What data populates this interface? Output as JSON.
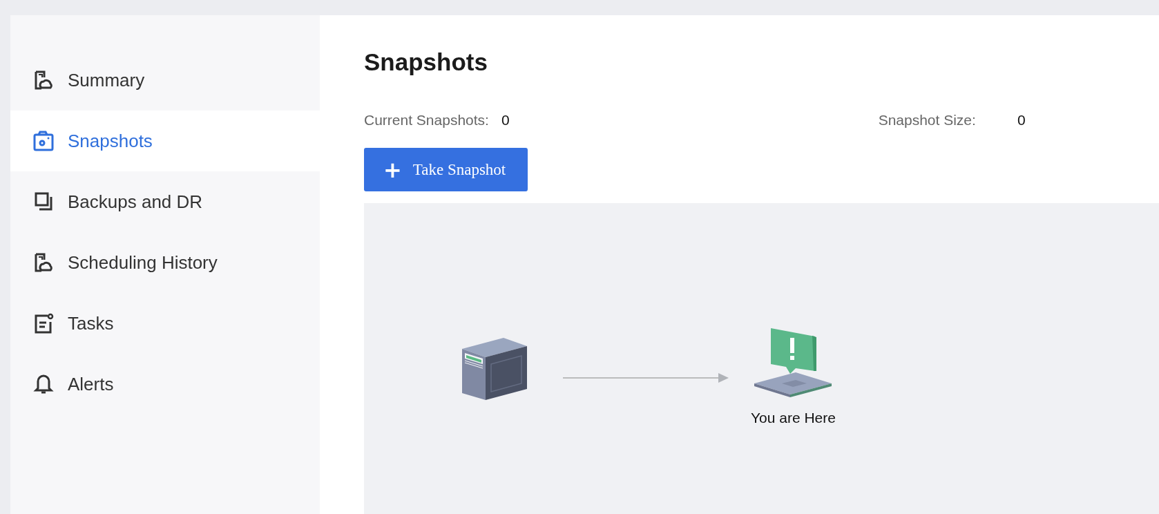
{
  "sidebar": {
    "items": [
      {
        "label": "Summary",
        "kind": "report",
        "selected": false
      },
      {
        "label": "Snapshots",
        "kind": "camera",
        "selected": true
      },
      {
        "label": "Backups and DR",
        "kind": "copy",
        "selected": false
      },
      {
        "label": "Scheduling History",
        "kind": "report",
        "selected": false
      },
      {
        "label": "Tasks",
        "kind": "task",
        "selected": false
      },
      {
        "label": "Alerts",
        "kind": "bell",
        "selected": false
      }
    ]
  },
  "page": {
    "title": "Snapshots",
    "stats": [
      {
        "label": "Current Snapshots:",
        "value": "0"
      },
      {
        "label": "Snapshot Size:",
        "value": "0"
      }
    ],
    "button": {
      "icon": "+",
      "label": "Take Snapshot"
    },
    "diagram": {
      "current_label": "You are Here"
    }
  }
}
